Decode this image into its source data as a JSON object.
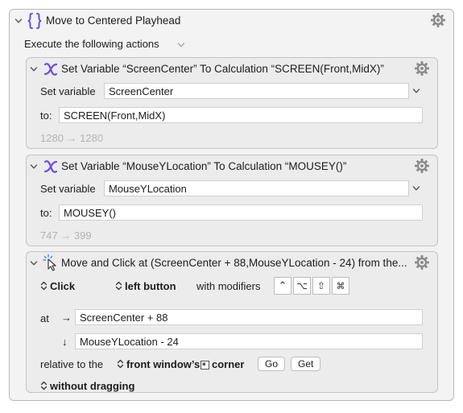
{
  "macro": {
    "title": "Move to Centered Playhead",
    "execute_label": "Execute the following actions"
  },
  "actions": [
    {
      "title": "Set Variable “ScreenCenter” To Calculation “SCREEN(Front,MidX)”",
      "set_variable_label": "Set variable",
      "variable_value": "ScreenCenter",
      "to_label": "to:",
      "calc_value": "SCREEN(Front,MidX)",
      "result_text": "1280 → 1280"
    },
    {
      "title": "Set Variable “MouseYLocation” To Calculation “MOUSEY()”",
      "set_variable_label": "Set variable",
      "variable_value": "MouseYLocation",
      "to_label": "to:",
      "calc_value": "MOUSEY()",
      "result_text": "747 → 399"
    },
    {
      "title": "Move and Click at (ScreenCenter + 88,MouseYLocation - 24) from the...",
      "click_type": "Click",
      "button": "left button",
      "modifiers_label": "with modifiers",
      "modifier_keys": [
        "⌃",
        "⌥",
        "⇧",
        "⌘"
      ],
      "at_label": "at",
      "x_arrow": "→",
      "x_value": "ScreenCenter + 88",
      "y_arrow": "↓",
      "y_value": "MouseYLocation - 24",
      "relative_label": "relative to the",
      "relative_value": "front window’s",
      "corner_label": "corner",
      "go_label": "Go",
      "get_label": "Get",
      "drag_option": "without dragging"
    }
  ],
  "colors": {
    "accent": "#6b4ce6",
    "gear": "#8a8a8a",
    "muted": "#b3b3b3"
  },
  "icons": {
    "macro": "curly-braces-icon",
    "calc": "variable-x-icon",
    "click": "mouse-click-icon",
    "settings": "gear-icon"
  }
}
